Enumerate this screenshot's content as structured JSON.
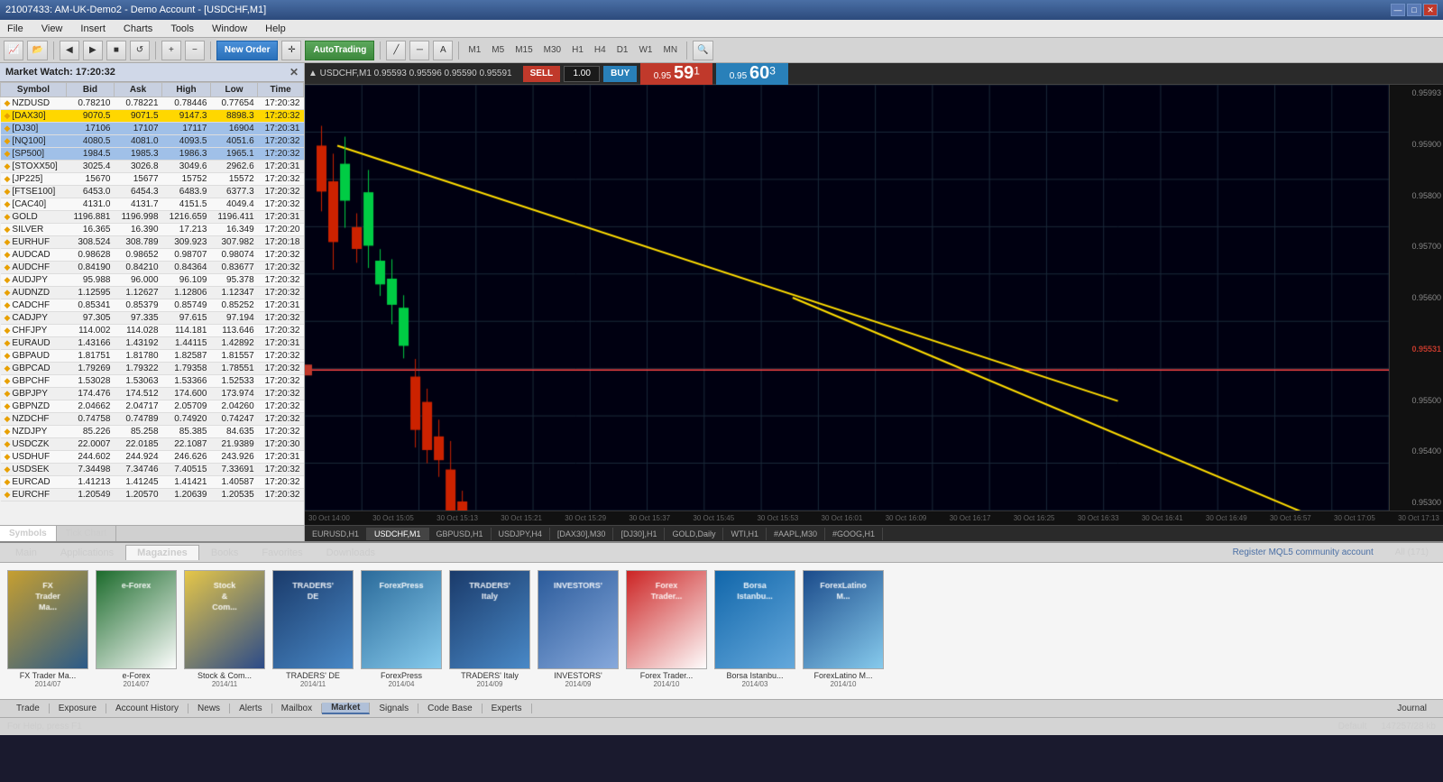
{
  "titlebar": {
    "title": "21007433: AM-UK-Demo2 - Demo Account - [USDCHF,M1]",
    "btn_min": "—",
    "btn_max": "□",
    "btn_close": "✕"
  },
  "menubar": {
    "items": [
      "File",
      "View",
      "Insert",
      "Charts",
      "Tools",
      "Window",
      "Help"
    ]
  },
  "toolbar": {
    "new_order": "New Order",
    "auto_trading": "AutoTrading"
  },
  "market_watch": {
    "header": "Market Watch: 17:20:32",
    "columns": [
      "Symbol",
      "Bid",
      "Ask",
      "High",
      "Low",
      "Time"
    ],
    "rows": [
      [
        "NZDUSD",
        "0.78210",
        "0.78221",
        "0.78446",
        "0.77654",
        "17:20:32"
      ],
      [
        "[DAX30]",
        "9070.5",
        "9071.5",
        "9147.3",
        "8898.3",
        "17:20:32"
      ],
      [
        "[DJ30]",
        "17106",
        "17107",
        "17117",
        "16904",
        "17:20:31"
      ],
      [
        "[NQ100]",
        "4080.5",
        "4081.0",
        "4093.5",
        "4051.6",
        "17:20:32"
      ],
      [
        "[SP500]",
        "1984.5",
        "1985.3",
        "1986.3",
        "1965.1",
        "17:20:32"
      ],
      [
        "[STOXX50]",
        "3025.4",
        "3026.8",
        "3049.6",
        "2962.6",
        "17:20:31"
      ],
      [
        "[JP225]",
        "15670",
        "15677",
        "15752",
        "15572",
        "17:20:32"
      ],
      [
        "[FTSE100]",
        "6453.0",
        "6454.3",
        "6483.9",
        "6377.3",
        "17:20:32"
      ],
      [
        "[CAC40]",
        "4131.0",
        "4131.7",
        "4151.5",
        "4049.4",
        "17:20:32"
      ],
      [
        "GOLD",
        "1196.881",
        "1196.998",
        "1216.659",
        "1196.411",
        "17:20:31"
      ],
      [
        "SILVER",
        "16.365",
        "16.390",
        "17.213",
        "16.349",
        "17:20:20"
      ],
      [
        "EURHUF",
        "308.524",
        "308.789",
        "309.923",
        "307.982",
        "17:20:18"
      ],
      [
        "AUDCAD",
        "0.98628",
        "0.98652",
        "0.98707",
        "0.98074",
        "17:20:32"
      ],
      [
        "AUDCHF",
        "0.84190",
        "0.84210",
        "0.84364",
        "0.83677",
        "17:20:32"
      ],
      [
        "AUDJPY",
        "95.988",
        "96.000",
        "96.109",
        "95.378",
        "17:20:32"
      ],
      [
        "AUDNZD",
        "1.12595",
        "1.12627",
        "1.12806",
        "1.12347",
        "17:20:32"
      ],
      [
        "CADCHF",
        "0.85341",
        "0.85379",
        "0.85749",
        "0.85252",
        "17:20:31"
      ],
      [
        "CADJPY",
        "97.305",
        "97.335",
        "97.615",
        "97.194",
        "17:20:32"
      ],
      [
        "CHFJPY",
        "114.002",
        "114.028",
        "114.181",
        "113.646",
        "17:20:32"
      ],
      [
        "EURAUD",
        "1.43166",
        "1.43192",
        "1.44115",
        "1.42892",
        "17:20:31"
      ],
      [
        "GBPAUD",
        "1.81751",
        "1.81780",
        "1.82587",
        "1.81557",
        "17:20:32"
      ],
      [
        "GBPCAD",
        "1.79269",
        "1.79322",
        "1.79358",
        "1.78551",
        "17:20:32"
      ],
      [
        "GBPCHF",
        "1.53028",
        "1.53063",
        "1.53366",
        "1.52533",
        "17:20:32"
      ],
      [
        "GBPJPY",
        "174.476",
        "174.512",
        "174.600",
        "173.974",
        "17:20:32"
      ],
      [
        "GBPNZD",
        "2.04662",
        "2.04717",
        "2.05709",
        "2.04260",
        "17:20:32"
      ],
      [
        "NZDCHF",
        "0.74758",
        "0.74789",
        "0.74920",
        "0.74247",
        "17:20:32"
      ],
      [
        "NZDJPY",
        "85.226",
        "85.258",
        "85.385",
        "84.635",
        "17:20:32"
      ],
      [
        "USDCZK",
        "22.0007",
        "22.0185",
        "22.1087",
        "21.9389",
        "17:20:30"
      ],
      [
        "USDHUF",
        "244.602",
        "244.924",
        "246.626",
        "243.926",
        "17:20:31"
      ],
      [
        "USDSEK",
        "7.34498",
        "7.34746",
        "7.40515",
        "7.33691",
        "17:20:32"
      ],
      [
        "EURCAD",
        "1.41213",
        "1.41245",
        "1.41421",
        "1.40587",
        "17:20:32"
      ],
      [
        "EURCHF",
        "1.20549",
        "1.20570",
        "1.20639",
        "1.20535",
        "17:20:32"
      ]
    ],
    "highlighted_row": 1,
    "tabs": [
      "Symbols",
      "Tick Chart"
    ]
  },
  "chart": {
    "symbol": "USDCHF,M1",
    "title": "▲ USDCHF,M1  0.95593 0.95596 0.95590 0.95591",
    "sell_label": "SELL",
    "buy_label": "BUY",
    "lot_size": "1.00",
    "sell_price": "0.95",
    "sell_big": "59",
    "sell_sup": "1",
    "buy_price": "0.95",
    "buy_big": "60",
    "buy_sup": "3",
    "timeframes": [
      "M1",
      "M5",
      "M15",
      "M30",
      "H1",
      "H4",
      "D1",
      "W1",
      "MN"
    ],
    "price_levels": [
      "0.95993",
      "0.95900",
      "0.95800",
      "0.95700",
      "0.95600",
      "0.95531",
      "0.95500",
      "0.95400",
      "0.95300"
    ],
    "time_labels": [
      "30 Oct 14:00",
      "30 Oct 15:05",
      "30 Oct 15:13",
      "30 Oct 15:21",
      "30 Oct 15:29",
      "30 Oct 15:37",
      "30 Oct 15:45",
      "30 Oct 15:53",
      "30 Oct 16:01",
      "30 Oct 16:09",
      "30 Oct 16:17",
      "30 Oct 16:25",
      "30 Oct 16:33",
      "30 Oct 16:41",
      "30 Oct 16:49",
      "30 Oct 16:57",
      "30 Oct 17:05",
      "30 Oct 17:13"
    ],
    "chart_tabs": [
      "EURUSD,H1",
      "USDCHF,M1",
      "GBPUSD,H1",
      "USDJPY,H4",
      "[DAX30],M30",
      "[DJ30],H1",
      "GOLD,Daily",
      "WTI,H1",
      "#AAPL,M30",
      "#GOOG,H1"
    ]
  },
  "bottom_panel": {
    "tabs": [
      "Main",
      "Applications",
      "Magazines",
      "Books",
      "Favorites",
      "Downloads"
    ],
    "active_tab": "Magazines",
    "register_link": "Register MQL5 community account",
    "filter": "All (171)",
    "magazines": [
      {
        "title": "FX Trader Ma...",
        "date": "2014/07",
        "color1": "#c8a030",
        "color2": "#2a5a8a"
      },
      {
        "title": "e-Forex",
        "date": "2014/07",
        "color1": "#1a6a2a",
        "color2": "#ffffff"
      },
      {
        "title": "Stock & Com...",
        "date": "2014/11",
        "color1": "#e8c848",
        "color2": "#2a4a8a"
      },
      {
        "title": "TRADERS' DE",
        "date": "2014/11",
        "color1": "#1a3a6a",
        "color2": "#4a8ac8"
      },
      {
        "title": "ForexPress",
        "date": "2014/04",
        "color1": "#2a6a9a",
        "color2": "#88ccee"
      },
      {
        "title": "TRADERS' Italy",
        "date": "2014/09",
        "color1": "#1a3a6a",
        "color2": "#4a8ac8"
      },
      {
        "title": "INVESTORS'",
        "date": "2014/09",
        "color1": "#2a5a9a",
        "color2": "#88aadd"
      },
      {
        "title": "Forex Trader...",
        "date": "2014/10",
        "color1": "#cc2222",
        "color2": "#ffffff"
      },
      {
        "title": "Borsa Istanbu...",
        "date": "2014/03",
        "color1": "#1166aa",
        "color2": "#66aadd"
      },
      {
        "title": "ForexLatino M...",
        "date": "2014/10",
        "color1": "#1a4a8a",
        "color2": "#88ccee"
      }
    ]
  },
  "statusbar": {
    "tabs": [
      "Trade",
      "Exposure",
      "Account History",
      "News",
      "Alerts",
      "Mailbox",
      "Market",
      "Signals",
      "Code Base",
      "Experts",
      "Journal"
    ],
    "active_tab": "Market",
    "status_left": "For Help, press F1",
    "status_right": "Default",
    "memory": "147257/28 kb"
  }
}
